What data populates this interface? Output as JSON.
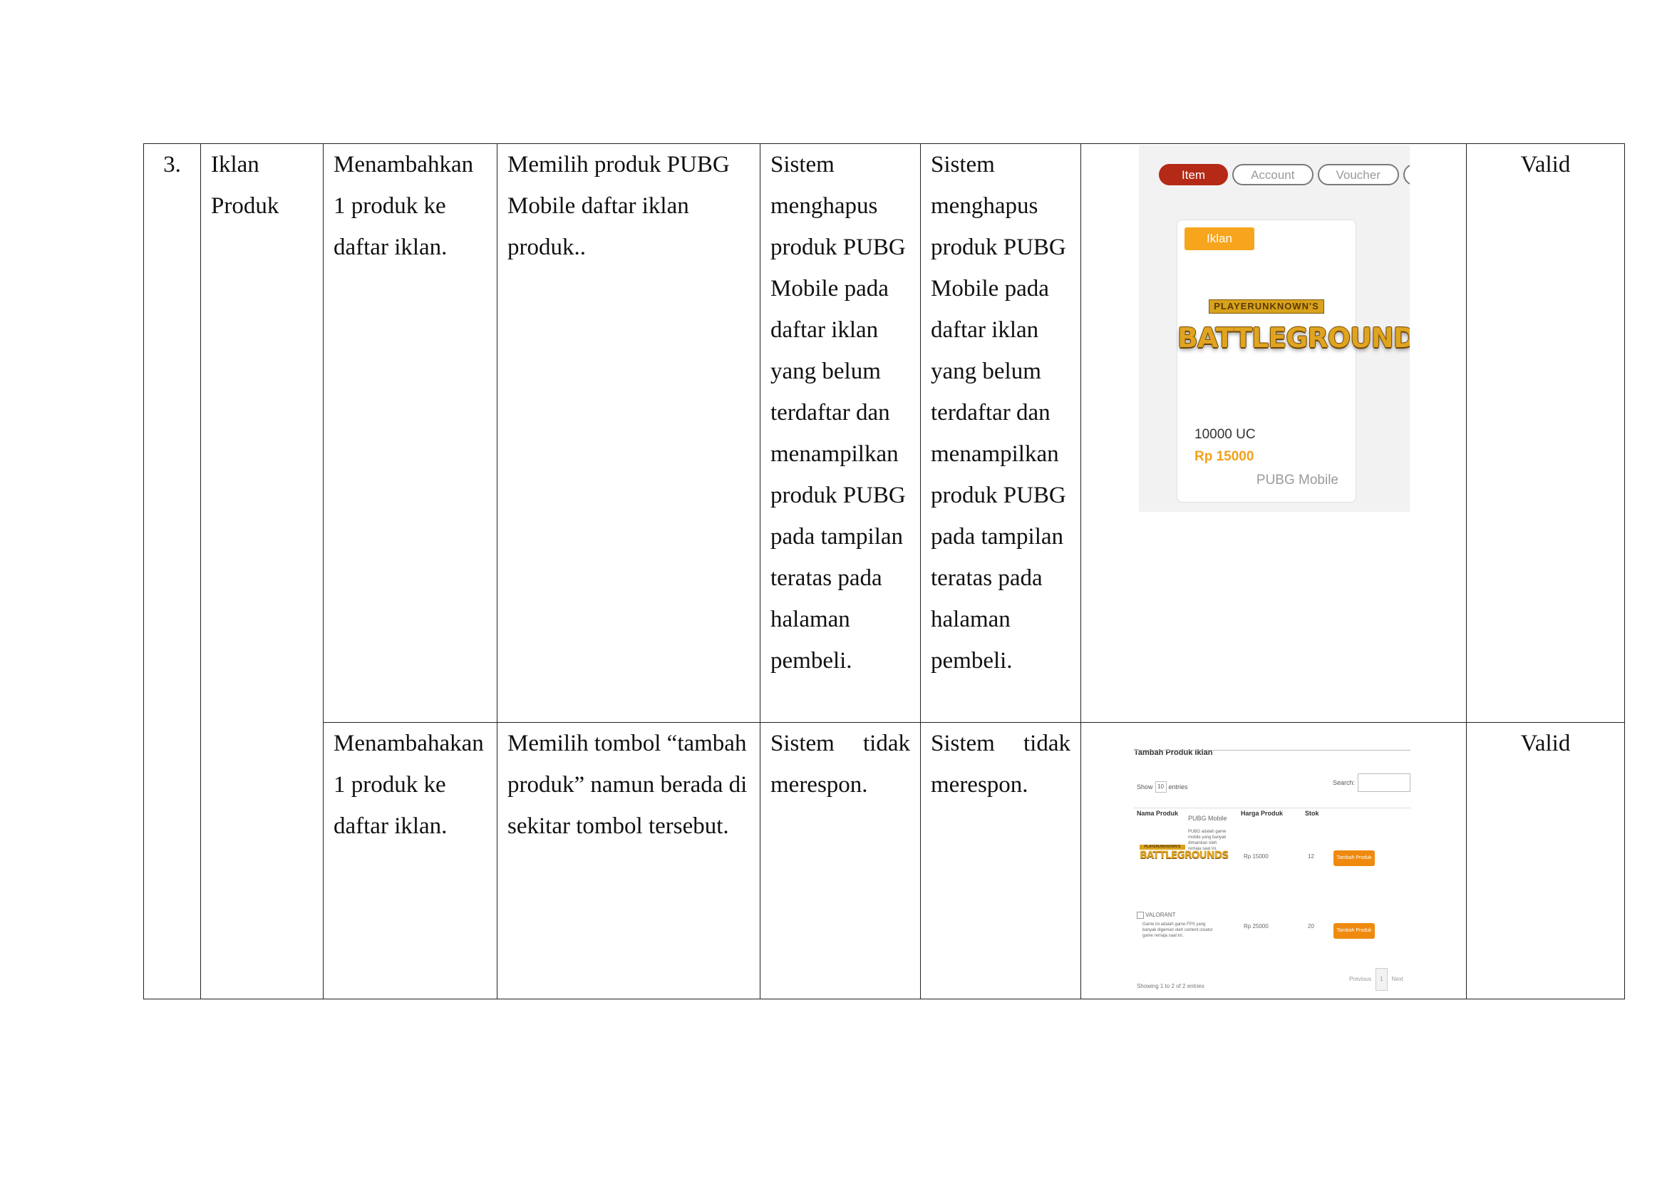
{
  "row1": {
    "no": "3.",
    "fitur": [
      "Iklan",
      "Produk"
    ],
    "skenario": [
      "Menambahkan",
      "1 produk ke",
      "daftar iklan."
    ],
    "langkah": [
      "Memilih produk PUBG",
      "Mobile daftar iklan",
      "produk.."
    ],
    "harapan": [
      "Sistem",
      "menghapus",
      "produk PUBG",
      "Mobile pada",
      "daftar iklan",
      "yang belum",
      "terdaftar dan",
      "menampilkan",
      "produk PUBG",
      "pada tampilan",
      "teratas pada",
      "halaman",
      "pembeli."
    ],
    "hasil": [
      "Sistem",
      "menghapus",
      "produk PUBG",
      "Mobile pada",
      "daftar iklan",
      "yang belum",
      "terdaftar dan",
      "menampilkan",
      "produk PUBG",
      "pada tampilan",
      "teratas pada",
      "halaman",
      "pembeli."
    ],
    "status": "Valid"
  },
  "row2": {
    "skenario": [
      "Menambahakan",
      "1 produk ke",
      "daftar iklan."
    ],
    "langkah": [
      "Memilih tombol “tambah",
      "produk” namun berada di",
      "sekitar tombol tersebut."
    ],
    "harapan": [
      "Sistem tidak",
      "merespon."
    ],
    "hasil": [
      "Sistem tidak",
      "merespon."
    ],
    "status": "Valid"
  },
  "shot1": {
    "tabs": [
      "Item",
      "Account",
      "Voucher",
      "C"
    ],
    "badge": "Iklan",
    "logo_top": "PLAYERUNKNOWN'S",
    "logo_main": "BATTLEGROUNDS",
    "amount": "10000 UC",
    "price": "Rp 15000",
    "game": "PUBG Mobile"
  },
  "shot2": {
    "title": "Tambah Produk Iklan",
    "show": "Show",
    "show_value": "10",
    "entries": "entries",
    "search": "Search:",
    "headers": [
      "Nama Produk",
      "Harga Produk",
      "Stok"
    ],
    "rows": [
      {
        "name": "PUBG Mobile",
        "desc": "PUBG adalah game mobile yang banyak dimainkan oleh remaja saat ini.",
        "logo_top": "PLAYERUNKNOWN'S",
        "logo_main": "BATTLEGROUNDS",
        "price": "Rp 15000",
        "stock": "12",
        "button": "Tambah Produk"
      },
      {
        "name": "VALORANT",
        "desc": "Game ini adalah game FPS yang banyak digemari oleh content creator game remaja saat ini.",
        "price": "Rp 25000",
        "stock": "20",
        "button": "Tambah Produk"
      }
    ],
    "footer": "Showing 1 to 2 of 2 entries",
    "previous": "Previous",
    "page": "1",
    "next": "Next"
  }
}
